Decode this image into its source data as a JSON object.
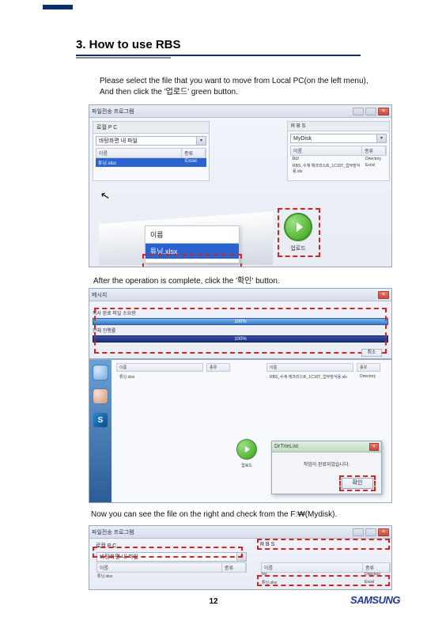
{
  "heading": "3. How to use RBS",
  "intro_line1": "Please select the file that you want to move from Local PC(on the left menu),",
  "intro_line2": "And then click the '업로드' green button.",
  "note_after_op": "After the operation is complete, click the '확인' button.",
  "note_final": "Now you can see the file on the right  and check from the F:₩(Mydisk).",
  "page_number": "12",
  "logo_text": "SAMSUNG",
  "ss1": {
    "title": "파일전송 프로그램",
    "left_panel_label": "로컬 P C",
    "left_combo": "바탕화면 내 파일",
    "left_hdr_name": "이름",
    "left_hdr_type": "종류",
    "left_row_sel": "튜닝.xlsx",
    "left_row_sel_type": "Excel",
    "right_panel_label": "R B S",
    "right_combo": "MyDisk",
    "right_hdr_name": "이름",
    "right_hdr_type": "종류",
    "right_row1": "bcr",
    "right_row1_type": "Directory",
    "right_row2": "RBS, 수계 체크리스트_1C10T_업무장식용.xls",
    "right_row2_type": "Excel",
    "zoom_header": "이름",
    "zoom_selected": "튜닝.xlsx",
    "upload_label": "업로드"
  },
  "ss2": {
    "title": "메시지",
    "sub": "복사 완료 파일 소요량",
    "pct": "100%",
    "row2": "전체 진행률",
    "btn": "취소"
  },
  "ss3": {
    "strip_s": "S",
    "list_file": "튜닝.xlsx",
    "list_right": "RBS_수계 체크리스트_1C10T_업무장식용.xls",
    "list_type": "Directory",
    "col_name": "이름",
    "col_type": "종류",
    "mid_label": "업로드",
    "dlg_title": "DrTrieList",
    "dlg_msg": "작업이 완료되었습니다.",
    "dlg_ok": "확인"
  },
  "ss4": {
    "title": "파일전송 프로그램",
    "left_label": "로컬 P C",
    "left_combo": "바탕화면 내 파일",
    "right_label": "R B S",
    "col_name": "이름",
    "col_type": "종류",
    "left_row1": "튜닝.xlsx",
    "right_row1": "bcr",
    "right_row1_type": "Directory",
    "right_row2": "튜닝.xlsx",
    "right_row2_type": "Excel"
  }
}
